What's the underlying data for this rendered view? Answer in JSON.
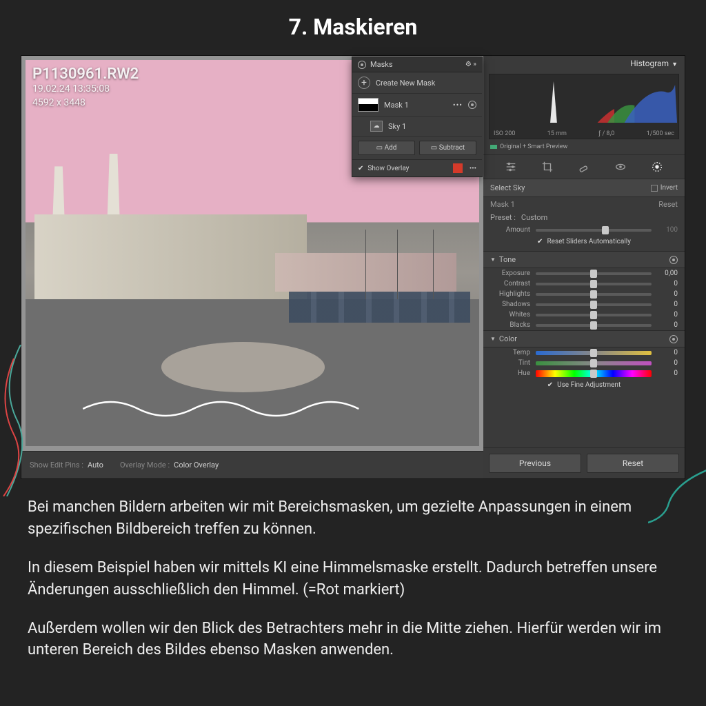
{
  "page": {
    "heading": "7. Maskieren"
  },
  "photo_meta": {
    "filename": "P1130961.RW2",
    "datetime": "19.02.24 13:35:08",
    "dimensions": "4592 x 3448"
  },
  "bottom_bar": {
    "pins_label": "Show Edit Pins :",
    "pins_value": "Auto",
    "overlay_label": "Overlay Mode :",
    "overlay_value": "Color Overlay"
  },
  "masks_panel": {
    "title": "Masks",
    "create": "Create New Mask",
    "mask_name": "Mask 1",
    "component_name": "Sky 1",
    "add": "Add",
    "subtract": "Subtract",
    "show_overlay": "Show Overlay",
    "overlay_color": "#d43a2a"
  },
  "right_panel": {
    "histogram_title": "Histogram",
    "hist_meta": {
      "iso": "ISO 200",
      "focal": "15 mm",
      "aperture": "ƒ / 8,0",
      "shutter": "1/500 sec"
    },
    "preview": "Original + Smart Preview",
    "select_label": "Select Sky",
    "invert": "Invert",
    "mask_label": "Mask 1",
    "reset": "Reset",
    "preset_label": "Preset :",
    "preset_value": "Custom",
    "amount_label": "Amount",
    "amount_value": "100",
    "auto_label": "Reset Sliders Automatically",
    "tone": {
      "title": "Tone",
      "exposure": {
        "label": "Exposure",
        "value": "0,00"
      },
      "contrast": {
        "label": "Contrast",
        "value": "0"
      },
      "highlights": {
        "label": "Highlights",
        "value": "0"
      },
      "shadows": {
        "label": "Shadows",
        "value": "0"
      },
      "whites": {
        "label": "Whites",
        "value": "0"
      },
      "blacks": {
        "label": "Blacks",
        "value": "0"
      }
    },
    "color": {
      "title": "Color",
      "temp": {
        "label": "Temp",
        "value": "0"
      },
      "tint": {
        "label": "Tint",
        "value": "0"
      },
      "hue": {
        "label": "Hue",
        "value": "0"
      },
      "fine": "Use Fine Adjustment"
    },
    "previous": "Previous",
    "reset_btn": "Reset"
  },
  "desc": {
    "p1": "Bei manchen Bildern arbeiten wir mit Bereichsmasken, um gezielte Anpassungen in einem spezifischen Bildbereich treffen zu können.",
    "p2": "In diesem Beispiel haben wir mittels KI eine Himmelsmaske erstellt. Dadurch betreffen unsere Änderungen ausschließlich den Himmel. (=Rot markiert)",
    "p3": "Außerdem wollen wir den Blick des Betrachters mehr in die Mitte ziehen. Hierfür werden wir im unteren Bereich des Bildes ebenso Masken anwenden."
  }
}
